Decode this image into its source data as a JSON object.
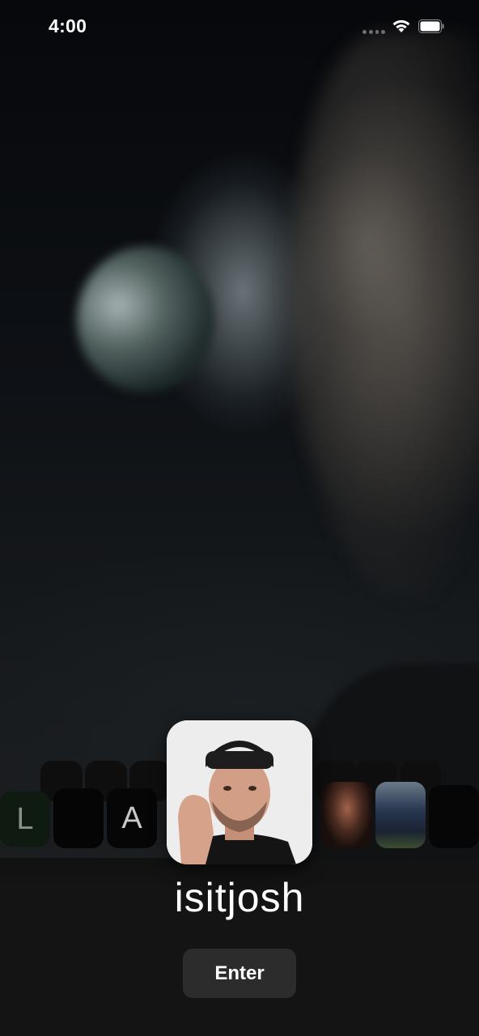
{
  "status_bar": {
    "time": "4:00",
    "icons": [
      "signal-icon",
      "wifi-icon",
      "battery-icon"
    ]
  },
  "carousel": {
    "left_tiles": [
      {
        "label": "L"
      },
      {
        "label": "A"
      }
    ],
    "selected_user": {
      "name": "isitjosh"
    }
  },
  "actions": {
    "enter_label": "Enter"
  },
  "colors": {
    "background": "#0b0c0e",
    "panel": "#141414",
    "button": "#2c2c2c",
    "text": "#ffffff"
  }
}
